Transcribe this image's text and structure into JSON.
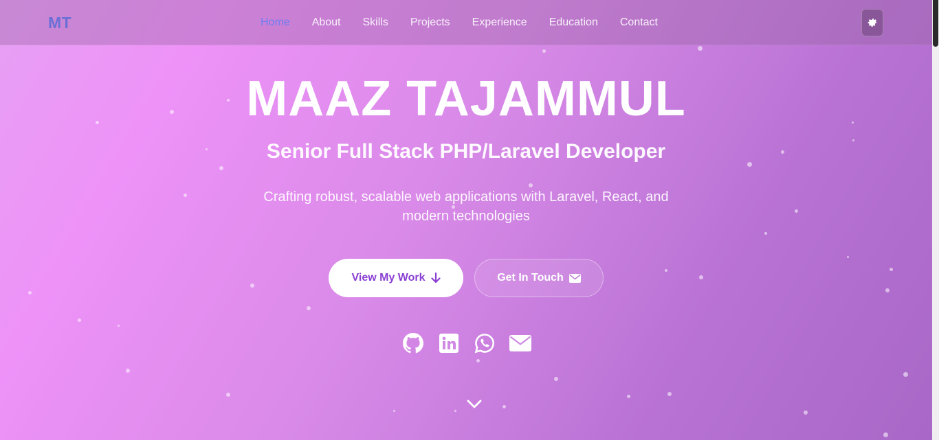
{
  "nav": {
    "logo": "MT",
    "items": [
      {
        "label": "Home",
        "active": true
      },
      {
        "label": "About"
      },
      {
        "label": "Skills"
      },
      {
        "label": "Projects"
      },
      {
        "label": "Experience"
      },
      {
        "label": "Education"
      },
      {
        "label": "Contact"
      }
    ],
    "theme_toggle_icon": "gear-icon"
  },
  "hero": {
    "name": "MAAZ TAJAMMUL",
    "role": "Senior Full Stack PHP/Laravel Developer",
    "tagline": "Crafting robust, scalable web applications with Laravel, React, and modern technologies",
    "primary_button": {
      "label": "View My Work",
      "icon": "arrow-down-icon"
    },
    "secondary_button": {
      "label": "Get In Touch",
      "icon": "envelope-icon"
    },
    "social": [
      "github-icon",
      "linkedin-icon",
      "whatsapp-icon",
      "email-icon"
    ],
    "scroll_icon": "chevron-down-icon"
  },
  "colors": {
    "gradient_start": "#ee92f8",
    "gradient_end": "#a867c6",
    "active_link": "#6f7ef3",
    "primary_button_text": "#8a3fd2"
  }
}
